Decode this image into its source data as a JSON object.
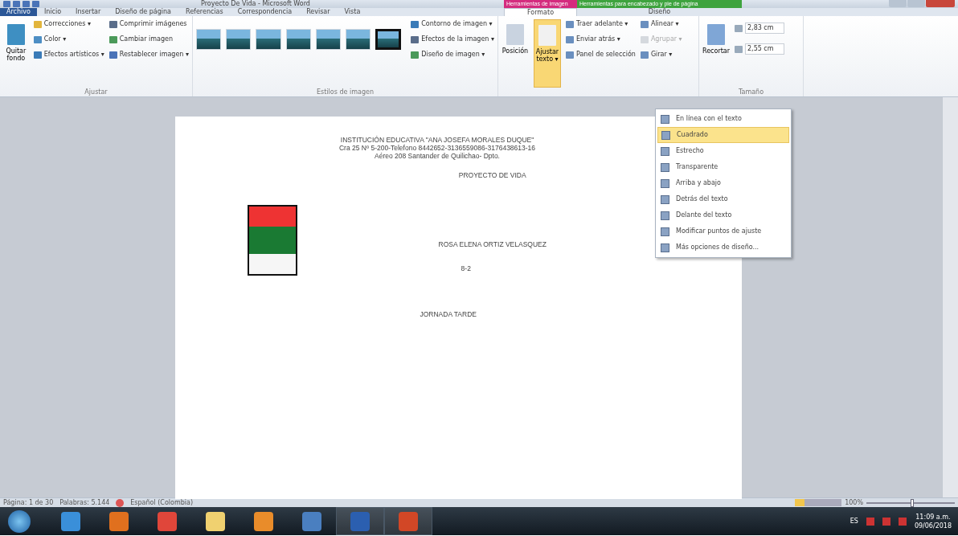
{
  "window": {
    "title": "Proyecto De Vida - Microsoft Word"
  },
  "contextual_groups": [
    {
      "label": "Herramientas de imagen",
      "color": "#d42b7e"
    },
    {
      "label": "Herramientas para encabezado y pie de página",
      "color": "#3ea33e"
    }
  ],
  "tabs": [
    {
      "label": "Archivo",
      "kind": "file",
      "selected": false
    },
    {
      "label": "Inicio",
      "kind": "tab",
      "selected": false
    },
    {
      "label": "Insertar",
      "kind": "tab",
      "selected": false
    },
    {
      "label": "Diseño de página",
      "kind": "tab",
      "selected": false
    },
    {
      "label": "Referencias",
      "kind": "tab",
      "selected": false
    },
    {
      "label": "Correspondencia",
      "kind": "tab",
      "selected": false
    },
    {
      "label": "Revisar",
      "kind": "tab",
      "selected": false
    },
    {
      "label": "Vista",
      "kind": "tab",
      "selected": false
    },
    {
      "label": "Formato",
      "kind": "context",
      "selected": true
    },
    {
      "label": "Diseño",
      "kind": "context",
      "selected": false
    }
  ],
  "ribbon": {
    "ajustar": {
      "label": "Ajustar",
      "large": "Quitar fondo",
      "items": [
        "Correcciones ▾",
        "Color ▾",
        "Efectos artísticos ▾",
        "Comprimir imágenes",
        "Cambiar imagen",
        "Restablecer imagen ▾"
      ]
    },
    "estilos": {
      "label": "Estilos de imagen",
      "styles": [
        {
          "selected": false
        },
        {
          "selected": false
        },
        {
          "selected": false
        },
        {
          "selected": false
        },
        {
          "selected": false
        },
        {
          "selected": false
        },
        {
          "selected": true
        }
      ],
      "items": [
        "Contorno de imagen ▾",
        "Efectos de la imagen ▾",
        "Diseño de imagen ▾"
      ]
    },
    "organizar": {
      "large": [
        {
          "label": "Posición",
          "active": false
        },
        {
          "label": "Ajustar texto ▾",
          "active": true
        }
      ],
      "items": [
        {
          "label": "Traer adelante ▾",
          "disabled": false
        },
        {
          "label": "Alinear ▾",
          "disabled": false
        },
        {
          "label": "Enviar atrás ▾",
          "disabled": false
        },
        {
          "label": "Agrupar ▾",
          "disabled": true
        },
        {
          "label": "Panel de selección",
          "disabled": false
        },
        {
          "label": "Girar ▾",
          "disabled": false
        }
      ]
    },
    "tamano": {
      "label": "Tamaño",
      "large": "Recortar",
      "height": "2,83 cm",
      "width": "2,55 cm"
    }
  },
  "wrap_menu": [
    {
      "label": "En línea con el texto",
      "selected": false
    },
    {
      "label": "Cuadrado",
      "selected": true
    },
    {
      "label": "Estrecho",
      "selected": false
    },
    {
      "label": "Transparente",
      "selected": false
    },
    {
      "label": "Arriba y abajo",
      "selected": false
    },
    {
      "label": "Detrás del texto",
      "selected": false
    },
    {
      "label": "Delante del texto",
      "selected": false
    },
    {
      "label": "Modificar puntos de ajuste",
      "selected": false
    },
    {
      "label": "Más opciones de diseño...",
      "selected": false
    }
  ],
  "document": {
    "header": [
      "INSTITUCIÓN  EDUCATIVA \"ANA JOSEFA MORALES DUQUE\"",
      "Cra 25 Nº 5-200-Telefono  8442652-3136559086-3176438613-16",
      "Aéreo 208 Santander  de Quilichao- Dpto."
    ],
    "title": "PROYECTO DE  VIDA",
    "name": "ROSA ELENA ORTIZ VELASQUEZ",
    "grade": "8-2",
    "shift": "JORNADA TARDE"
  },
  "status_bar": {
    "page": "Página: 1 de 30",
    "words": "Palabras: 5.144",
    "language": "Español (Colombia)",
    "zoom": "100%",
    "zoom_level": {
      "level": 0.5
    }
  },
  "taskbar": {
    "language": "ES",
    "time": "11:09 a.m.",
    "date": "09/06/2018"
  }
}
